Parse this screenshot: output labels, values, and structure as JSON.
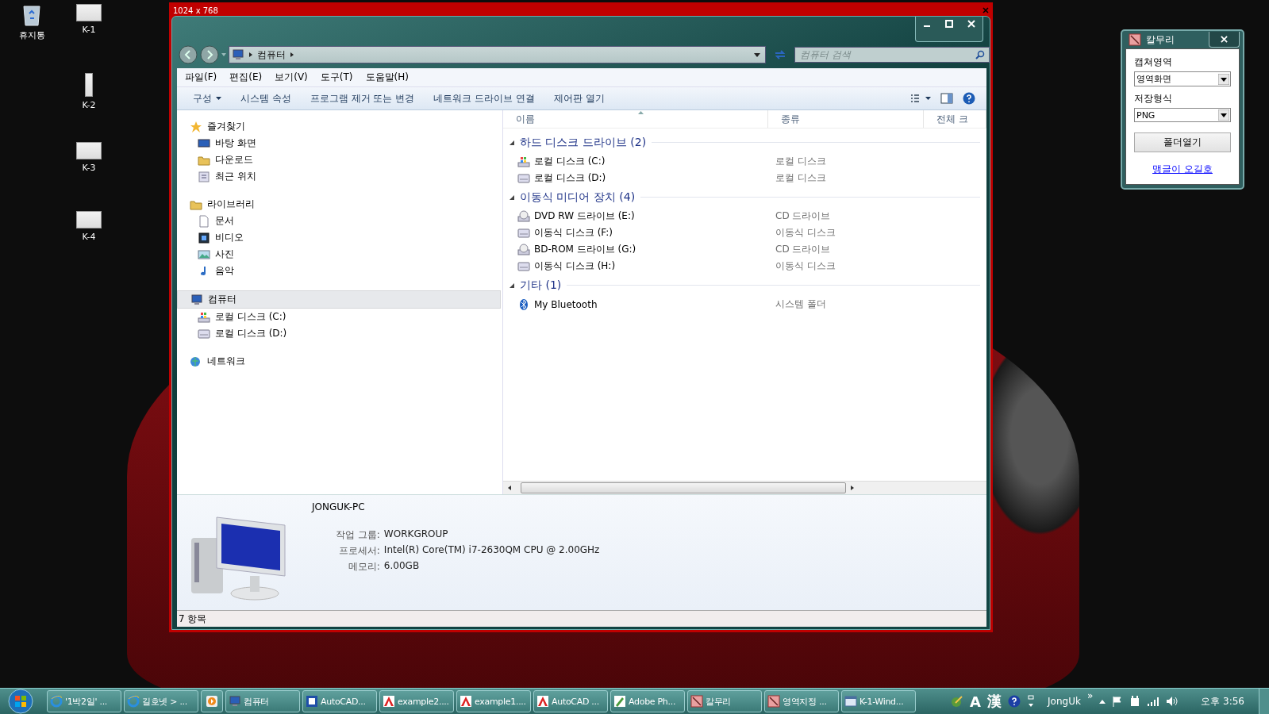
{
  "desktop_icons": [
    {
      "label": "휴지통",
      "kind": "recycle"
    },
    {
      "label": "K-1",
      "kind": "thumb"
    },
    {
      "label": "K-2",
      "kind": "tall"
    },
    {
      "label": "K-3",
      "kind": "thumb"
    },
    {
      "label": "K-4",
      "kind": "thumb"
    }
  ],
  "capture_frame": {
    "title": "1024 x 768"
  },
  "explorer": {
    "address": {
      "crumbs": [
        "컴퓨터"
      ]
    },
    "search": {
      "placeholder": "컴퓨터 검색"
    },
    "menu": [
      "파일(F)",
      "편집(E)",
      "보기(V)",
      "도구(T)",
      "도움말(H)"
    ],
    "toolbar": [
      {
        "label": "구성",
        "dropdown": true
      },
      {
        "label": "시스템 속성",
        "dropdown": false
      },
      {
        "label": "프로그램 제거 또는 변경",
        "dropdown": false
      },
      {
        "label": "네트워크 드라이브 연결",
        "dropdown": false
      },
      {
        "label": "제어판 열기",
        "dropdown": false
      }
    ],
    "nav": [
      {
        "label": "즐겨찾기",
        "kind": "star",
        "selected": false,
        "children": [
          {
            "label": "바탕 화면",
            "kind": "desktop",
            "selected": false
          },
          {
            "label": "다운로드",
            "kind": "folder",
            "selected": false
          },
          {
            "label": "최근 위치",
            "kind": "recent",
            "selected": false
          }
        ]
      },
      {
        "label": "라이브러리",
        "kind": "library",
        "selected": false,
        "children": [
          {
            "label": "문서",
            "kind": "doc",
            "selected": false
          },
          {
            "label": "비디오",
            "kind": "video",
            "selected": false
          },
          {
            "label": "사진",
            "kind": "picture",
            "selected": false
          },
          {
            "label": "음악",
            "kind": "music",
            "selected": false
          }
        ]
      },
      {
        "label": "컴퓨터",
        "kind": "computer",
        "selected": true,
        "children": [
          {
            "label": "로컬 디스크 (C:)",
            "kind": "sysdrive",
            "selected": false
          },
          {
            "label": "로컬 디스크 (D:)",
            "kind": "drive",
            "selected": false
          }
        ]
      },
      {
        "label": "네트워크",
        "kind": "network",
        "selected": false
      }
    ],
    "columns": [
      "이름",
      "종류",
      "전체 크"
    ],
    "groups": [
      {
        "title": "하드 디스크 드라이브 (2)",
        "items": [
          {
            "name": "로컬 디스크 (C:)",
            "type": "로컬 디스크",
            "kind": "sysdrive"
          },
          {
            "name": "로컬 디스크 (D:)",
            "type": "로컬 디스크",
            "kind": "drive"
          }
        ]
      },
      {
        "title": "이동식 미디어 장치 (4)",
        "items": [
          {
            "name": "DVD RW 드라이브 (E:)",
            "type": "CD 드라이브",
            "kind": "optical"
          },
          {
            "name": "이동식 디스크 (F:)",
            "type": "이동식 디스크",
            "kind": "drive"
          },
          {
            "name": "BD-ROM 드라이브 (G:)",
            "type": "CD 드라이브",
            "kind": "optical"
          },
          {
            "name": "이동식 디스크 (H:)",
            "type": "이동식 디스크",
            "kind": "drive"
          }
        ]
      },
      {
        "title": "기타 (1)",
        "items": [
          {
            "name": "My Bluetooth",
            "type": "시스템 폴더",
            "kind": "bluetooth"
          }
        ]
      }
    ],
    "details": {
      "name": "JONGUK-PC",
      "fields": [
        {
          "label": "작업 그룹:",
          "value": "WORKGROUP"
        },
        {
          "label": "프로세서:",
          "value": "Intel(R) Core(TM) i7-2630QM CPU @ 2.00GHz"
        },
        {
          "label": "메모리:",
          "value": "6.00GB"
        }
      ]
    },
    "status": "7 항목"
  },
  "gadget": {
    "title": "칼무리",
    "fields": [
      {
        "label": "캡쳐영역",
        "value": "영역화면"
      },
      {
        "label": "저장형식",
        "value": "PNG"
      }
    ],
    "button": "폴더열기",
    "link": "맹글이 오길호"
  },
  "taskbar": {
    "buttons": [
      {
        "label": "'1박2일' ...",
        "kind": "ie"
      },
      {
        "label": "길호넷 > ...",
        "kind": "ie"
      },
      {
        "kind": "media"
      },
      {
        "label": "컴퓨터",
        "kind": "computer"
      },
      {
        "label": "AutoCAD...",
        "kind": "autocad-blue"
      },
      {
        "label": "example2....",
        "kind": "autocad"
      },
      {
        "label": "example1....",
        "kind": "autocad"
      },
      {
        "label": "AutoCAD ...",
        "kind": "autocad"
      },
      {
        "label": "Adobe Ph...",
        "kind": "photoshop"
      },
      {
        "label": "칼무리",
        "kind": "kalmuri"
      },
      {
        "label": "영역지정 ...",
        "kind": "kalmuri"
      },
      {
        "label": "K-1-Wind...",
        "kind": "window"
      }
    ],
    "ime": [
      "A",
      "漢"
    ],
    "user": "JongUk",
    "more": "»",
    "clock": "오후 3:56"
  }
}
